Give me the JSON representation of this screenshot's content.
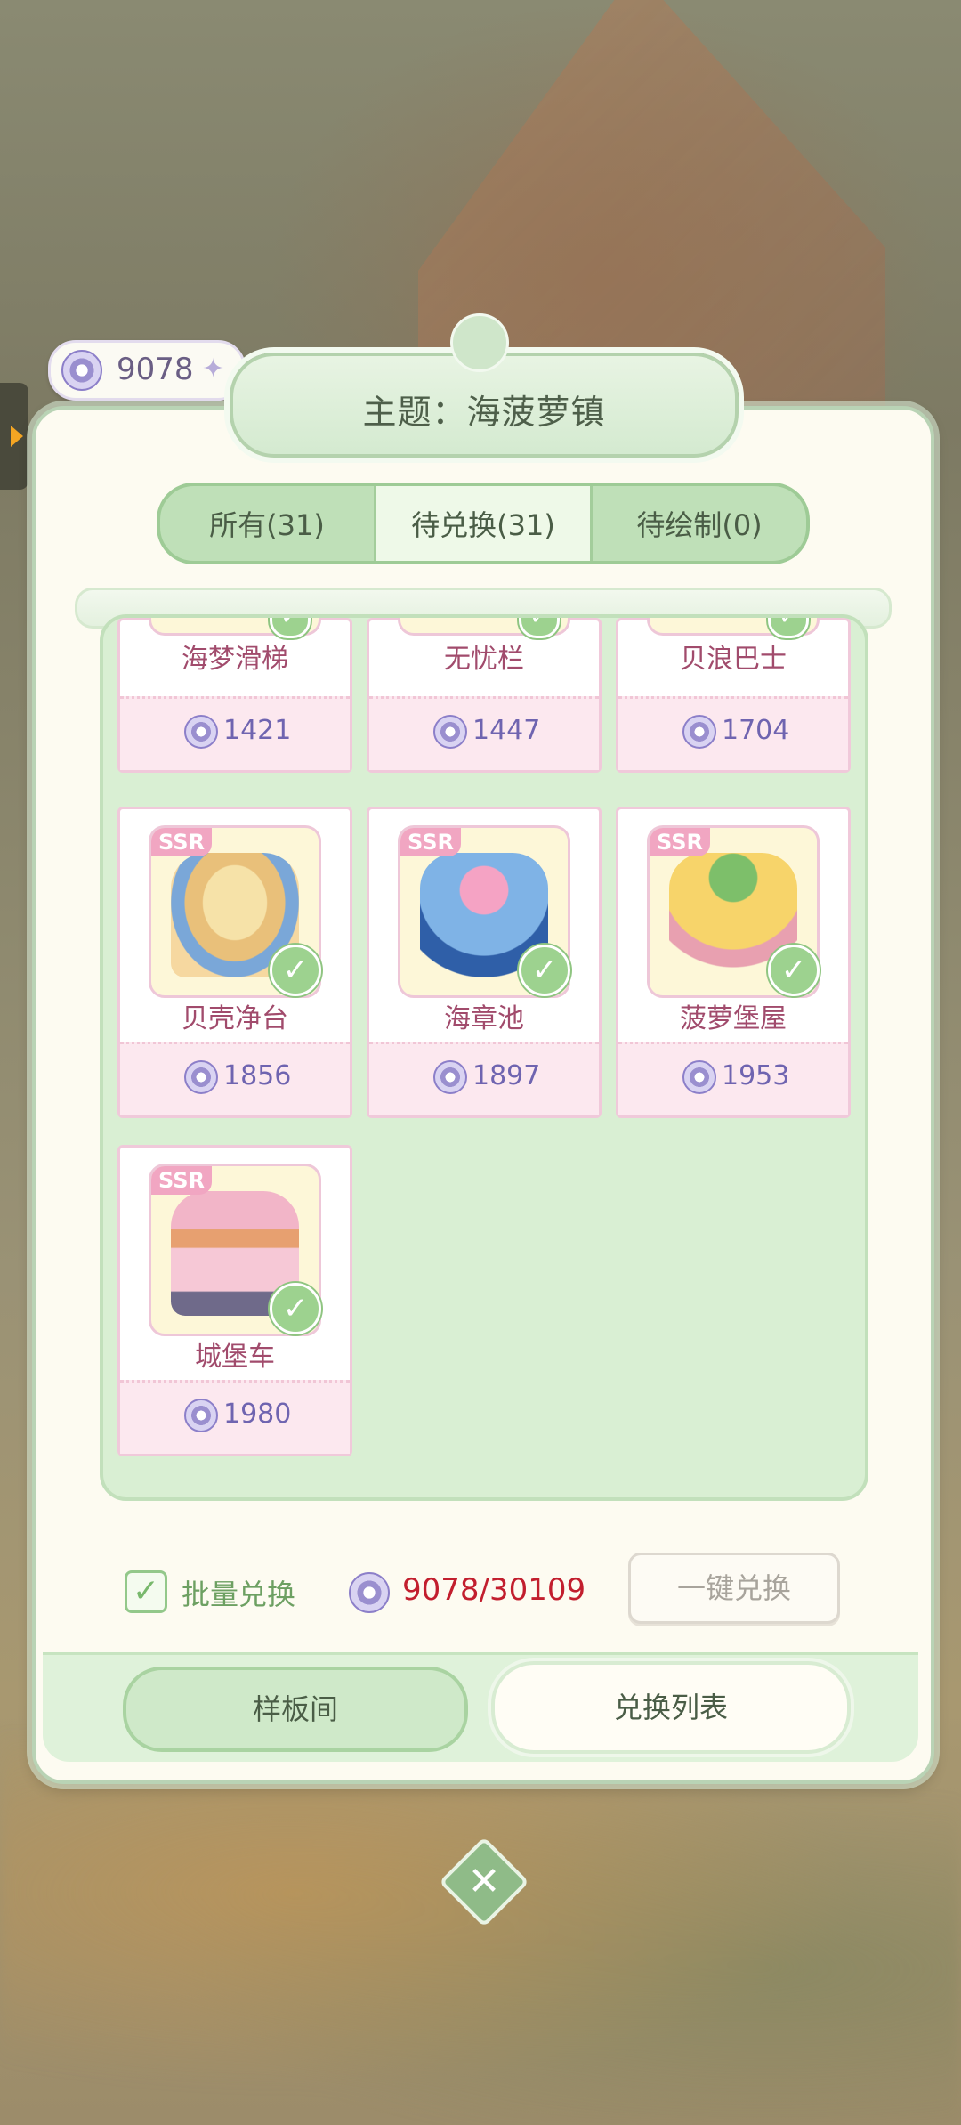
{
  "currency": {
    "balance": "9078",
    "plus_icon": "plus-sparkle-icon"
  },
  "header": {
    "title": "主题：海菠萝镇"
  },
  "tabs": [
    {
      "label": "所有(31)"
    },
    {
      "label": "待兑换(31)"
    },
    {
      "label": "待绘制(0)"
    }
  ],
  "items": [
    {
      "name": "海梦滑梯",
      "price": "1421"
    },
    {
      "name": "无忧栏",
      "price": "1447"
    },
    {
      "name": "贝浪巴士",
      "price": "1704"
    },
    {
      "name": "贝壳净台",
      "price": "1856",
      "rarity": "SSR"
    },
    {
      "name": "海章池",
      "price": "1897",
      "rarity": "SSR"
    },
    {
      "name": "菠萝堡屋",
      "price": "1953",
      "rarity": "SSR"
    },
    {
      "name": "城堡车",
      "price": "1980",
      "rarity": "SSR"
    }
  ],
  "footer": {
    "batch_label": "批量兑换",
    "total": "9078/30109",
    "one_key_label": "一键兑换",
    "left_button": "样板间",
    "right_button": "兑换列表"
  },
  "colors": {
    "accent_green": "#9ecb96",
    "price_red": "#c21e2e",
    "name_pink": "#a14b6c"
  }
}
